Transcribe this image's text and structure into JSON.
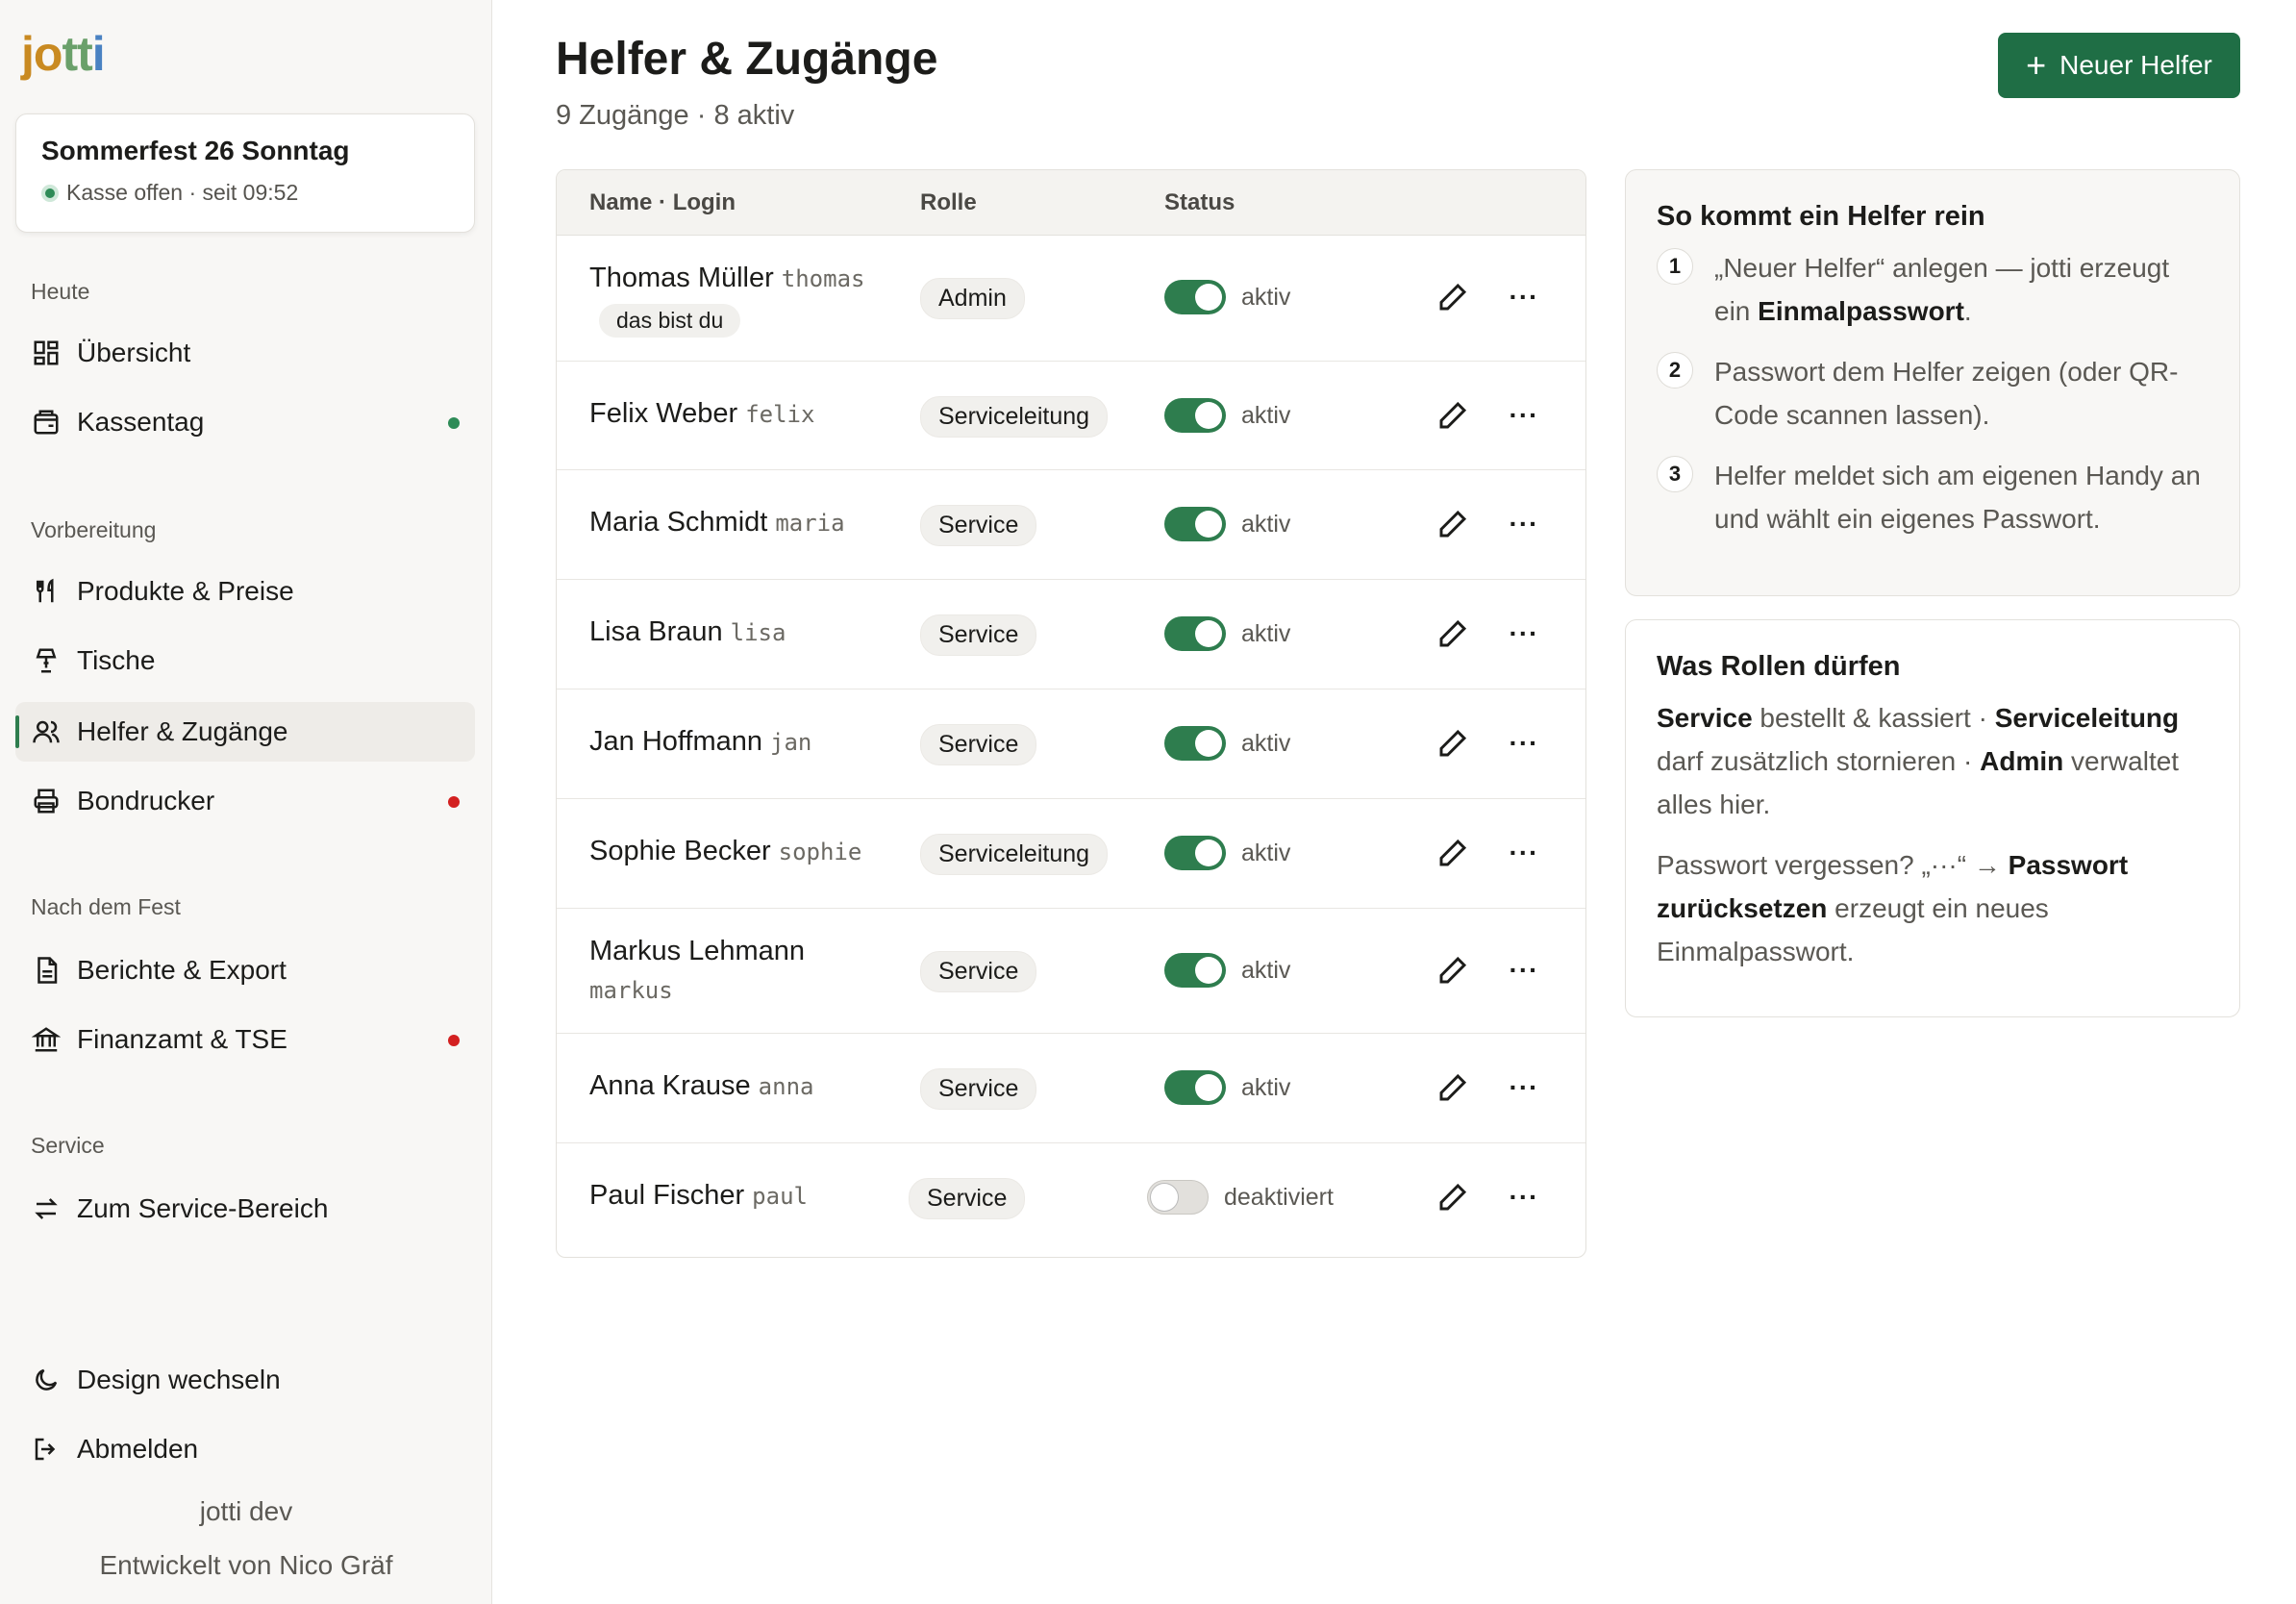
{
  "app": {
    "logo": [
      "jo",
      "tt",
      "i"
    ],
    "event_title": "Sommerfest 26 Sonntag",
    "event_status": "Kasse offen · seit 09:52"
  },
  "sidebar": {
    "sections": {
      "today": "Heute",
      "prep": "Vorbereitung",
      "after": "Nach dem Fest",
      "service": "Service"
    },
    "items": [
      {
        "label": "Übersicht",
        "icon": "grid-icon"
      },
      {
        "label": "Kassentag",
        "icon": "register-icon",
        "dot": "#2e8b57"
      },
      {
        "label": "Produkte & Preise",
        "icon": "cutlery-icon"
      },
      {
        "label": "Tische",
        "icon": "table-icon"
      },
      {
        "label": "Helfer & Zugänge",
        "icon": "users-icon",
        "active": true
      },
      {
        "label": "Bondrucker",
        "icon": "printer-icon",
        "dot": "#d32020"
      },
      {
        "label": "Berichte & Export",
        "icon": "document-icon"
      },
      {
        "label": "Finanzamt & TSE",
        "icon": "bank-icon",
        "dot": "#d32020"
      },
      {
        "label": "Zum Service-Bereich",
        "icon": "switch-icon"
      }
    ],
    "bottom": {
      "design": "Design wechseln",
      "logout": "Abmelden",
      "version": "jotti dev",
      "credit": "Entwickelt von Nico Gräf"
    }
  },
  "header": {
    "title": "Helfer & Zugänge",
    "subtitle": "9 Zugänge · 8 aktiv",
    "new_button": "Neuer Helfer"
  },
  "table": {
    "columns": [
      "Name · Login",
      "Rolle",
      "Status"
    ],
    "you_label": "das bist du",
    "rows": [
      {
        "name": "Thomas Müller",
        "login": "thomas",
        "role": "Admin",
        "status": "aktiv",
        "active": true,
        "you": true
      },
      {
        "name": "Felix Weber",
        "login": "felix",
        "role": "Serviceleitung",
        "status": "aktiv",
        "active": true
      },
      {
        "name": "Maria Schmidt",
        "login": "maria",
        "role": "Service",
        "status": "aktiv",
        "active": true
      },
      {
        "name": "Lisa Braun",
        "login": "lisa",
        "role": "Service",
        "status": "aktiv",
        "active": true
      },
      {
        "name": "Jan Hoffmann",
        "login": "jan",
        "role": "Service",
        "status": "aktiv",
        "active": true
      },
      {
        "name": "Sophie Becker",
        "login": "sophie",
        "role": "Serviceleitung",
        "status": "aktiv",
        "active": true
      },
      {
        "name": "Markus Lehmann",
        "login": "markus",
        "role": "Service",
        "status": "aktiv",
        "active": true
      },
      {
        "name": "Anna Krause",
        "login": "anna",
        "role": "Service",
        "status": "aktiv",
        "active": true
      },
      {
        "name": "Paul Fischer",
        "login": "paul",
        "role": "Service",
        "status": "deaktiviert",
        "active": false
      }
    ]
  },
  "help_card": {
    "title": "So kommt ein Helfer rein",
    "steps": [
      {
        "num": "1",
        "text": "„Neuer Helfer“ anlegen — jotti erzeugt ein ",
        "bold": "Einmalpasswort",
        "after": "."
      },
      {
        "num": "2",
        "text": "Passwort dem Helfer zeigen (oder QR-Code scannen lassen).",
        "bold": "",
        "after": ""
      },
      {
        "num": "3",
        "text": "Helfer meldet sich am eigenen Handy an und wählt ein eigenes Passwort.",
        "bold": "",
        "after": ""
      }
    ]
  },
  "roles_card": {
    "title": "Was Rollen dürfen",
    "p1": {
      "b1": "Service",
      "t1": " bestellt & kassiert · ",
      "b2": "Serviceleitung",
      "t2": " darf zusätzlich stornieren · ",
      "b3": "Admin",
      "t3": " verwaltet alles hier."
    },
    "p2": {
      "t1": "Passwort vergessen? „···“ → ",
      "b1": "Passwort zurücksetzen",
      "t2": " erzeugt ein neues Einmalpasswort."
    }
  },
  "colors": {
    "accent": "#1f6e45",
    "toggle_on": "#2e7d4e",
    "alert_dot": "#d32020",
    "ok_dot": "#2e8b57"
  }
}
